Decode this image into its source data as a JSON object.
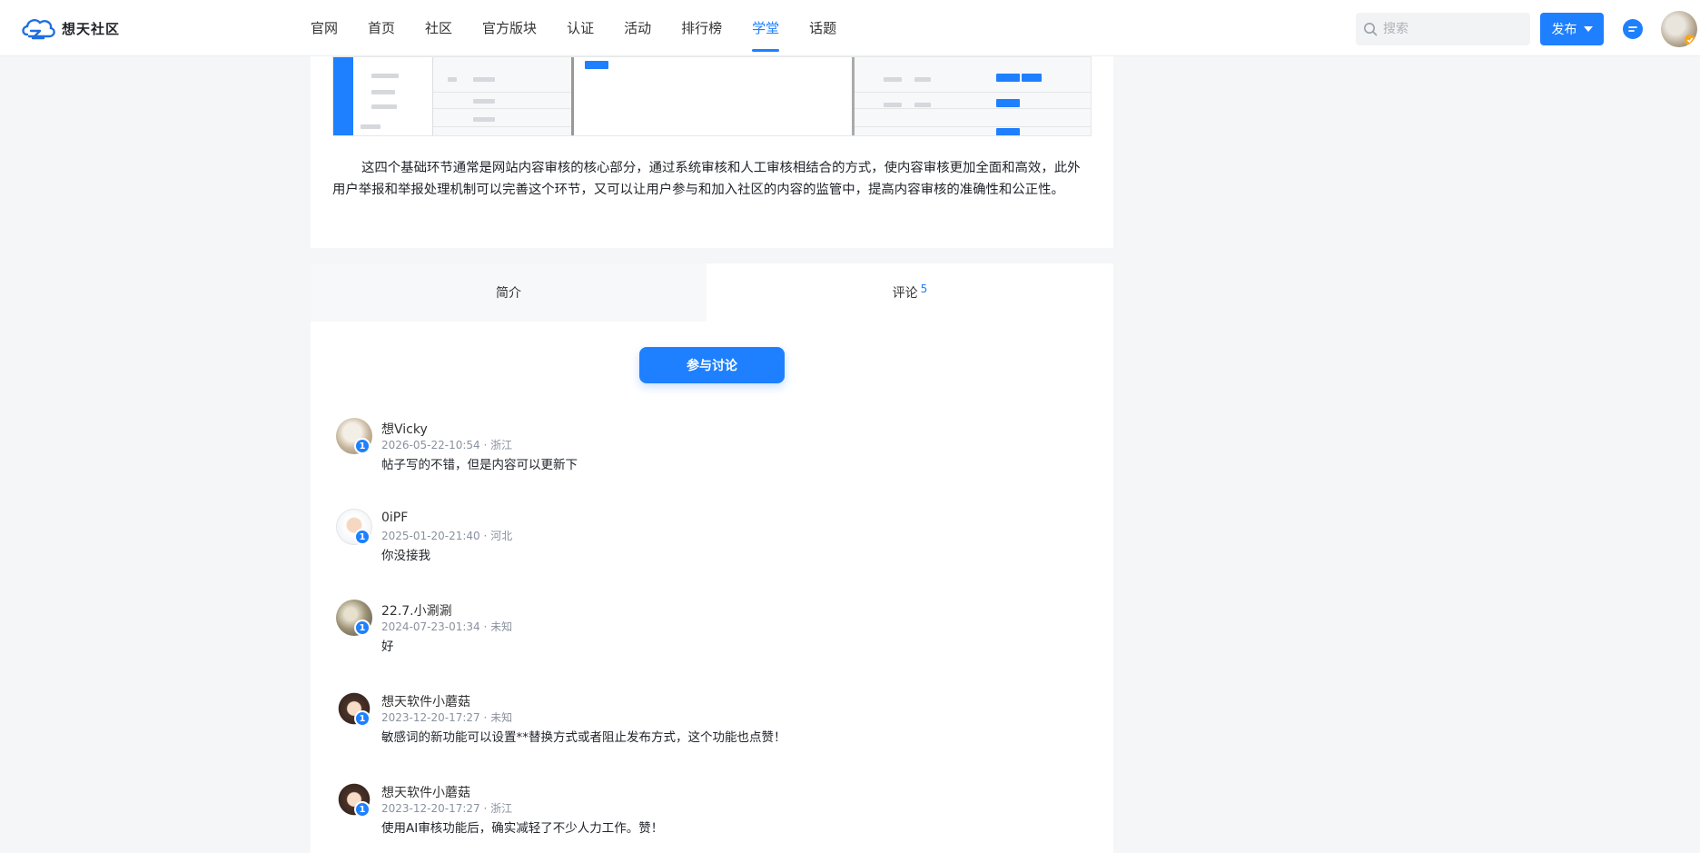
{
  "header": {
    "logo_text": "想天社区",
    "nav": [
      "官网",
      "首页",
      "社区",
      "官方版块",
      "认证",
      "活动",
      "排行榜",
      "学堂",
      "话题"
    ],
    "active_nav_index": 7,
    "search_placeholder": "搜索",
    "publish_label": "发布",
    "colors": {
      "accent": "#1e80ff"
    }
  },
  "article": {
    "paragraph": "这四个基础环节通常是网站内容审核的核心部分，通过系统审核和人工审核相结合的方式，使内容审核更加全面和高效，此外用户举报和举报处理机制可以完善这个环节，又可以让用户参与和加入社区的内容的监管中，提高内容审核的准确性和公正性。"
  },
  "tabs": {
    "intro_label": "简介",
    "comments_label": "评论",
    "comments_count": "5"
  },
  "join_label": "参与讨论",
  "comments": [
    {
      "name": "想Vicky",
      "meta": "2026-05-22-10:54 · 浙江",
      "text": "帖子写的不错，但是内容可以更新下",
      "level": "1"
    },
    {
      "name": "0iPF",
      "meta": "2025-01-20-21:40 · 河北",
      "text": "你没接我",
      "level": "1"
    },
    {
      "name": "22.7.小涮涮",
      "meta": "2024-07-23-01:34 · 未知",
      "text": "好",
      "level": "1"
    },
    {
      "name": "想天软件小蘑菇",
      "meta": "2023-12-20-17:27 · 未知",
      "text": "敏感词的新功能可以设置**替换方式或者阻止发布方式，这个功能也点赞！",
      "level": "1"
    },
    {
      "name": "想天软件小蘑菇",
      "meta": "2023-12-20-17:27 · 浙江",
      "text": "使用AI审核功能后，确实减轻了不少人力工作。赞！",
      "level": "1"
    }
  ]
}
